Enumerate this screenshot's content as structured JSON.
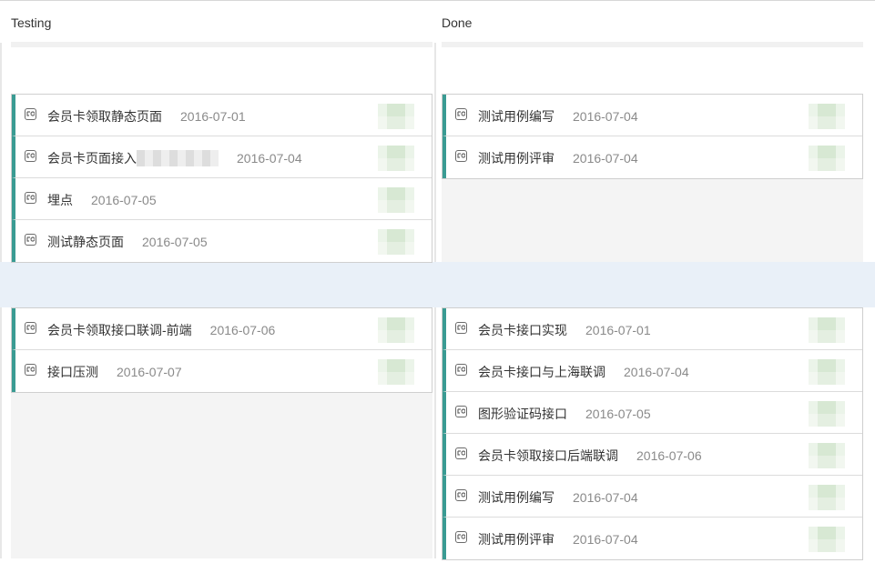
{
  "columns": {
    "testing": {
      "label": "Testing"
    },
    "done": {
      "label": "Done"
    }
  },
  "lanes": [
    {
      "testing": [
        {
          "title": "会员卡领取静态页面",
          "date": "2016-07-01"
        },
        {
          "title": "会员卡页面接入",
          "redacted": true,
          "date": "2016-07-04"
        },
        {
          "title": "埋点",
          "date": "2016-07-05"
        },
        {
          "title": "测试静态页面",
          "date": "2016-07-05"
        }
      ],
      "done": [
        {
          "title": "测试用例编写",
          "date": "2016-07-04"
        },
        {
          "title": "测试用例评审",
          "date": "2016-07-04"
        }
      ]
    },
    {
      "testing": [
        {
          "title": "会员卡领取接口联调-前端",
          "date": "2016-07-06"
        },
        {
          "title": "接口压测",
          "date": "2016-07-07"
        }
      ],
      "done": [
        {
          "title": "会员卡接口实现",
          "date": "2016-07-01"
        },
        {
          "title": "会员卡接口与上海联调",
          "date": "2016-07-04"
        },
        {
          "title": "图形验证码接口",
          "date": "2016-07-05"
        },
        {
          "title": "会员卡领取接口后端联调",
          "date": "2016-07-06"
        },
        {
          "title": "测试用例编写",
          "date": "2016-07-04"
        },
        {
          "title": "测试用例评审",
          "date": "2016-07-04"
        }
      ]
    }
  ],
  "colors": {
    "card_accent": "#3a9b93",
    "lane_divider": "#e9f0f8",
    "column_bg": "#f4f4f4"
  },
  "icons": {
    "card_type": "card-type-icon",
    "assignee": "assignee-avatar"
  }
}
